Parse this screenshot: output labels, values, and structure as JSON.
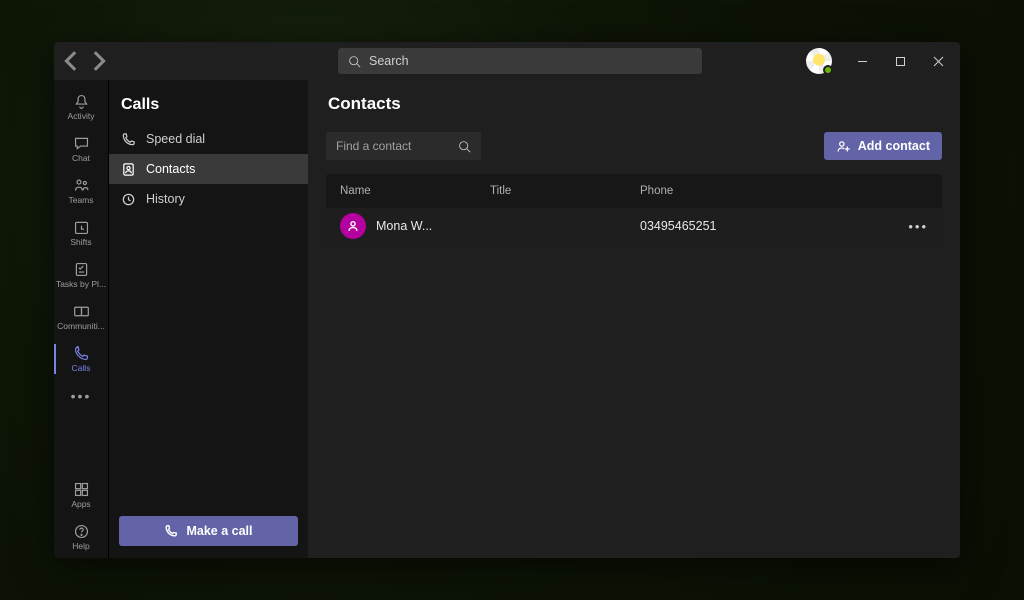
{
  "titlebar": {
    "search_placeholder": "Search"
  },
  "app_rail": {
    "items": [
      {
        "key": "activity",
        "label": "Activity"
      },
      {
        "key": "chat",
        "label": "Chat"
      },
      {
        "key": "teams",
        "label": "Teams"
      },
      {
        "key": "shifts",
        "label": "Shifts"
      },
      {
        "key": "tasks",
        "label": "Tasks by Pl..."
      },
      {
        "key": "communities",
        "label": "Communiti..."
      },
      {
        "key": "calls",
        "label": "Calls"
      }
    ],
    "apps_label": "Apps",
    "help_label": "Help"
  },
  "calls_panel": {
    "title": "Calls",
    "speed_dial": "Speed dial",
    "contacts": "Contacts",
    "history": "History",
    "make_a_call": "Make a call"
  },
  "main": {
    "title": "Contacts",
    "find_placeholder": "Find a contact",
    "add_contact": "Add contact",
    "columns": {
      "name": "Name",
      "title": "Title",
      "phone": "Phone"
    },
    "rows": [
      {
        "name": "Mona W...",
        "title": "",
        "phone": "03495465251"
      }
    ]
  }
}
